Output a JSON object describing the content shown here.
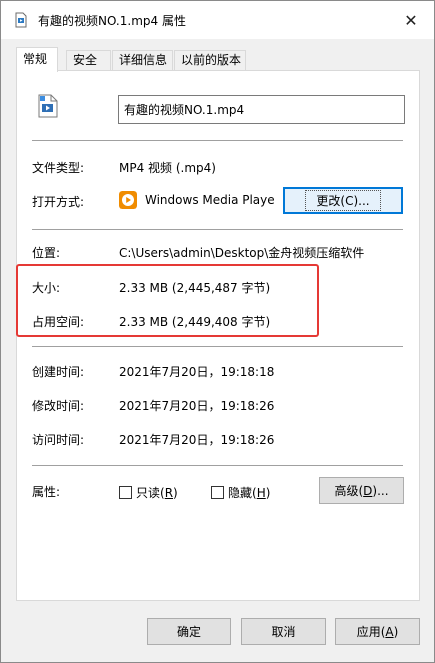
{
  "window": {
    "title": "有趣的视频NO.1.mp4 属性",
    "close_glyph": "✕"
  },
  "tabs": [
    {
      "label": "常规"
    },
    {
      "label": "安全"
    },
    {
      "label": "详细信息"
    },
    {
      "label": "以前的版本"
    }
  ],
  "general": {
    "file_name": "有趣的视频NO.1.mp4",
    "file_type_label": "文件类型:",
    "file_type_value": "MP4 视频 (.mp4)",
    "open_with_label": "打开方式:",
    "open_with_value": "Windows Media Playe",
    "change_button": "更改(C)...",
    "location_label": "位置:",
    "location_value": "C:\\Users\\admin\\Desktop\\金舟视频压缩软件",
    "size_label": "大小:",
    "size_value": "2.33 MB (2,445,487 字节)",
    "disk_size_label": "占用空间:",
    "disk_size_value": "2.33 MB (2,449,408 字节)",
    "created_label": "创建时间:",
    "created_value": "2021年7月20日，19:18:18",
    "modified_label": "修改时间:",
    "modified_value": "2021年7月20日，19:18:26",
    "accessed_label": "访问时间:",
    "accessed_value": "2021年7月20日，19:18:26",
    "attributes_label": "属性:",
    "readonly_text": "只读",
    "readonly_key": "R",
    "hidden_text": "隐藏",
    "hidden_key": "H",
    "advanced_text": "高级",
    "advanced_key": "D"
  },
  "footer": {
    "ok": "确定",
    "cancel": "取消",
    "apply_text": "应用",
    "apply_key": "A"
  },
  "colors": {
    "highlight_border": "#e53935",
    "wmp_icon": "#f08c00",
    "focus_border": "#0078d7"
  }
}
